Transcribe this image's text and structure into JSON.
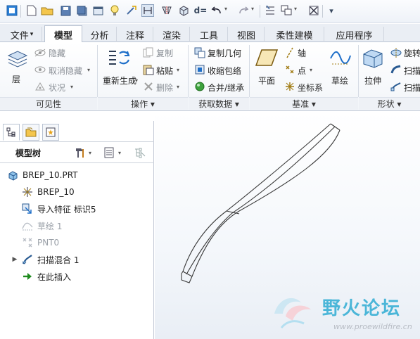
{
  "tabs": [
    "文件",
    "模型",
    "分析",
    "注释",
    "渲染",
    "工具",
    "视图",
    "柔性建模",
    "应用程序"
  ],
  "tab_file_arrow": "▾",
  "ribbon": {
    "visibility": {
      "layer_label": "层",
      "hide_label": "隐藏",
      "unhide_label": "取消隐藏",
      "status_label": "状况",
      "group_label": "可见性 "
    },
    "operations": {
      "regenerate_label": "重新生成",
      "copy_label": "复制",
      "paste_label": "粘贴",
      "delete_label": "删除",
      "group_label": "操作 ▾"
    },
    "get_data": {
      "copy_geom_label": "复制几何",
      "shrinkwrap_label": "收缩包络",
      "merge_label": "合并/继承",
      "group_label": "获取数据 ▾"
    },
    "datum": {
      "plane_label": "平面",
      "axis_label": "轴",
      "point_label": "点",
      "csys_label": "坐标系",
      "sketch_label": "草绘",
      "group_label": "基准 ▾"
    },
    "shapes": {
      "extrude_label": "拉伸",
      "revolve_label": "旋转",
      "sweep_label": "扫描",
      "swept_blend_label": "扫描",
      "group_label": "形状 ▾"
    }
  },
  "panel": {
    "title": "模型树",
    "tree": [
      {
        "label": "BREP_10.PRT",
        "icon": "part-icon",
        "disabled": false
      },
      {
        "label": "BREP_10",
        "icon": "csys-icon",
        "disabled": false
      },
      {
        "label": "导入特征 标识5",
        "icon": "import-feature-icon",
        "disabled": false
      },
      {
        "label": "草绘 1",
        "icon": "sketch-icon",
        "disabled": true
      },
      {
        "label": "PNT0",
        "icon": "datum-point-icon",
        "disabled": true
      },
      {
        "label": "扫描混合 1",
        "icon": "swept-blend-icon",
        "disabled": false
      },
      {
        "label": "在此插入",
        "icon": "insert-here-arrow-icon",
        "disabled": false
      }
    ]
  },
  "watermark": {
    "title": "野火论坛",
    "url": "www.proewildfire.cn"
  },
  "colors": {
    "accent": "#1f6fc9",
    "watermark": "#4bb6d8",
    "model_edge": "#3a3a3a"
  }
}
